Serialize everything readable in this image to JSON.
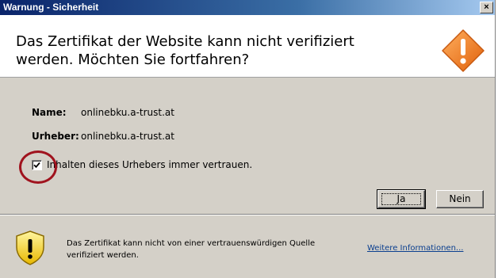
{
  "window": {
    "title": "Warnung - Sicherheit",
    "close_label": "×"
  },
  "header": {
    "headline": "Das Zertifikat der Website kann nicht verifiziert werden.  Möchten Sie fortfahren?",
    "icon": "warning-diamond-icon",
    "icon_color": "#f07818"
  },
  "details": {
    "name_label": "Name:",
    "name_value": "onlinebku.a-trust.at",
    "publisher_label": "Urheber:",
    "publisher_value": "onlinebku.a-trust.at"
  },
  "trust_checkbox": {
    "label": "Inhalten dieses Urhebers immer vertrauen.",
    "checked": true
  },
  "buttons": {
    "yes_label": "Ja",
    "no_label": "Nein"
  },
  "footer": {
    "icon": "warning-shield-icon",
    "text": "Das Zertifikat kann nicht von einer vertrauenswürdigen Quelle verifiziert werden.",
    "more_info_label": "Weitere Informationen..."
  },
  "annotation": {
    "color": "#a0131e"
  }
}
